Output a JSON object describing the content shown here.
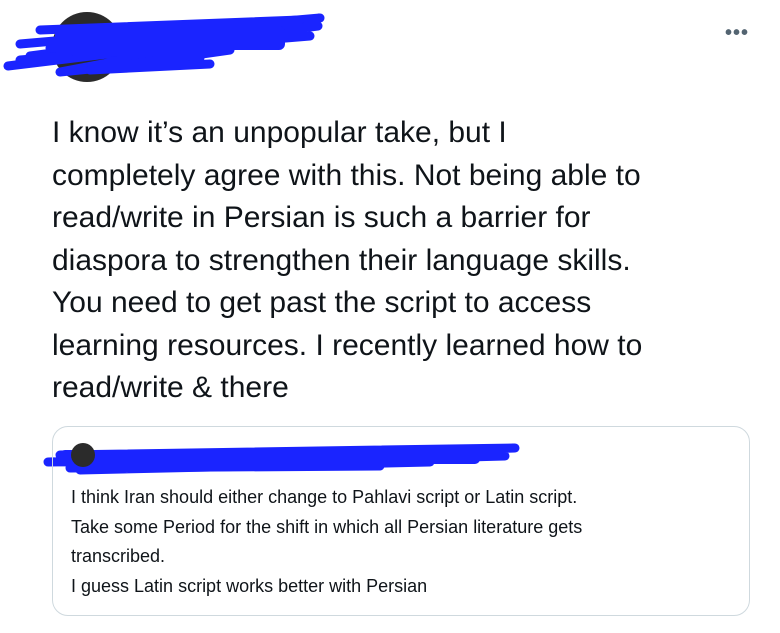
{
  "tweet": {
    "author": {
      "display_name": "",
      "handle": ""
    },
    "more_options_label": "•••",
    "text": "I know it’s an unpopular take, but I\ncompletely agree with this. Not being able to\nread/write in Persian is such a barrier for\ndiaspora to strengthen their language skills.\nYou need to get past the script to access\nlearning resources. I recently learned how to\nread/write & there"
  },
  "quoted_tweet": {
    "author": {
      "display_name": ""
    },
    "text": "I think Iran should either change to Pahlavi script or Latin script.\nTake some Period for the shift in which all Persian literature gets\ntranscribed.\nI guess Latin script works better with Persian"
  },
  "colors": {
    "redaction": "#1a24ff",
    "border": "#cfd9de",
    "secondary_text": "#536471"
  }
}
